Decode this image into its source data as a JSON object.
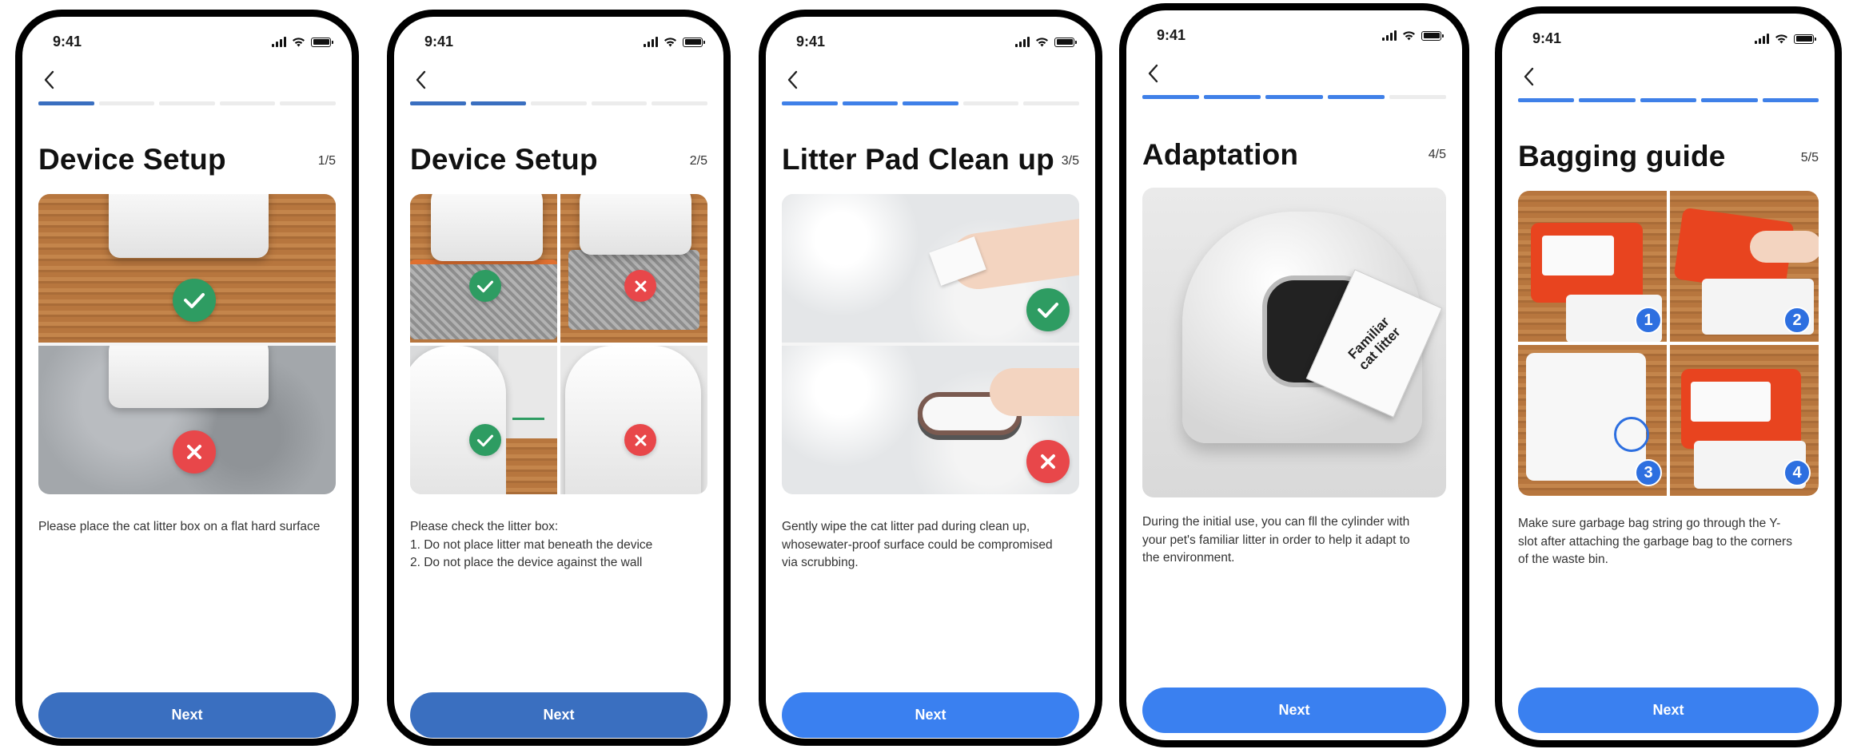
{
  "status": {
    "time": "9:41"
  },
  "screens": [
    {
      "title": "Device Setup",
      "counter": "1/5",
      "steps_done": 1,
      "description": [
        "Please place the cat litter box on a flat hard surface"
      ],
      "next_label": "Next"
    },
    {
      "title": "Device Setup",
      "counter": "2/5",
      "steps_done": 2,
      "description": [
        "Please check the litter box:",
        "1. Do not place litter mat beneath the device",
        "2. Do not place the device against the wall"
      ],
      "next_label": "Next"
    },
    {
      "title": "Litter Pad Clean up",
      "counter": "3/5",
      "steps_done": 3,
      "description": [
        "Gently wipe the cat litter pad during clean up,",
        "whosewater-proof surface could be compromised",
        "via scrubbing."
      ],
      "next_label": "Next"
    },
    {
      "title": "Adaptation",
      "counter": "4/5",
      "steps_done": 4,
      "image_text": "Familiar cat litter",
      "description": [
        "During the initial use, you can fll the cylinder with",
        "your pet's familiar litter in order to help it adapt to",
        "the environment."
      ],
      "next_label": "Next"
    },
    {
      "title": "Bagging guide",
      "counter": "5/5",
      "steps_done": 5,
      "step_numbers": [
        "1",
        "2",
        "3",
        "4"
      ],
      "description": [
        "Make sure garbage bag string go through the Y-",
        "slot after attaching the garbage bag to the corners",
        "of the waste bin."
      ],
      "next_label": "Next"
    }
  ],
  "colors": {
    "accent_dark": "#3a6fc0",
    "accent": "#3a80f0",
    "ok": "#2e9c62",
    "error": "#e8474a"
  },
  "icons": [
    "back-chevron-icon",
    "signal-icon",
    "wifi-icon",
    "battery-icon",
    "checkmark-icon",
    "cross-icon"
  ]
}
